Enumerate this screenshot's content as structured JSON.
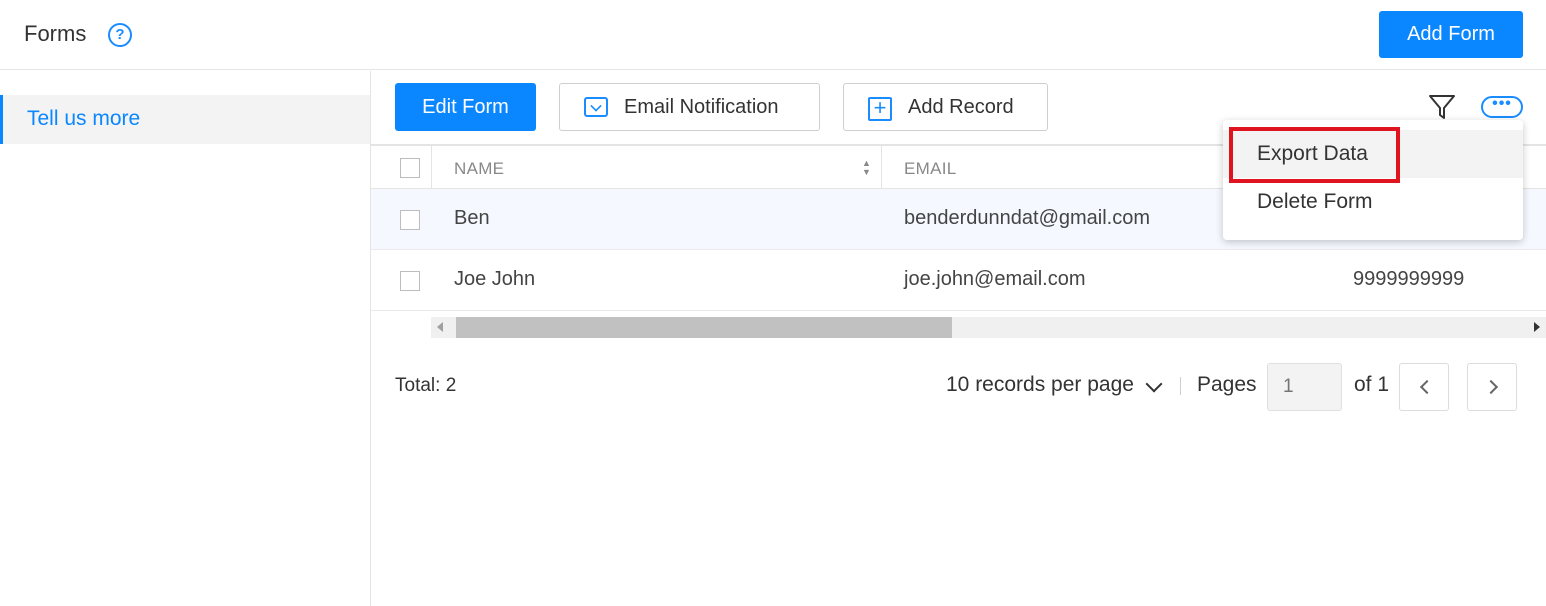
{
  "header": {
    "title": "Forms",
    "help_icon": "?",
    "add_form_label": "Add Form"
  },
  "sidebar": {
    "items": [
      {
        "label": "Tell us more",
        "active": true
      }
    ]
  },
  "toolbar": {
    "edit_form_label": "Edit Form",
    "email_notification_label": "Email Notification",
    "add_record_label": "Add Record",
    "filter_icon": "filter-icon",
    "more_icon": "•••"
  },
  "table": {
    "columns": [
      "NAME",
      "EMAIL"
    ],
    "rows": [
      {
        "name": "Ben",
        "email": "benderdunndat@gmail.com",
        "phone": ""
      },
      {
        "name": "Joe John",
        "email": "joe.john@email.com",
        "phone": "9999999999"
      }
    ]
  },
  "footer": {
    "total_label": "Total: 2",
    "per_page_label": "10 records per page",
    "pages_label": "Pages",
    "page_placeholder": "1",
    "of_label": "of 1"
  },
  "dropdown": {
    "items": [
      {
        "label": "Export Data",
        "highlighted": true
      },
      {
        "label": "Delete Form",
        "highlighted": false
      }
    ]
  },
  "colors": {
    "accent": "#0a87ff",
    "highlight_box": "#e0141e"
  }
}
